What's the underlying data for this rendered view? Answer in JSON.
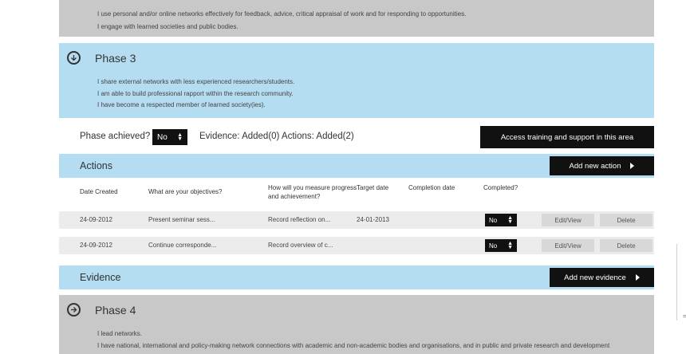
{
  "previous_phase": {
    "lines": [
      "I use personal and/or online networks effectively for feedback, advice, critical appraisal of work and for responding to opportunities.",
      "I engage with learned societies and public bodies."
    ]
  },
  "phase3": {
    "title": "Phase 3",
    "lines": [
      "I share external networks with less experienced researchers/students.",
      "I am able to build professional rapport within the research community.",
      "I have become a respected member of learned society(ies)."
    ]
  },
  "status": {
    "phase_achieved_label": "Phase achieved?",
    "phase_achieved_value": "No",
    "summary": "Evidence: Added(0) Actions: Added(2)",
    "access_button": "Access training and support in this area"
  },
  "actions": {
    "title": "Actions",
    "add_button": "Add new action",
    "headers": [
      "Date Created",
      "What are your objectives?",
      "How will you measure progress and achievement?",
      "Target date",
      "Completion date",
      "Completed?"
    ],
    "rows": [
      {
        "date_created": "24-09-2012",
        "objective": "Present seminar sess...",
        "measure": "Record reflection on...",
        "target_date": "24-01-2013",
        "completion_date": "",
        "completed": "No",
        "edit": "Edit/View",
        "delete": "Delete"
      },
      {
        "date_created": "24-09-2012",
        "objective": "Continue corresponde...",
        "measure": "Record overview of c...",
        "target_date": "",
        "completion_date": "",
        "completed": "No",
        "edit": "Edit/View",
        "delete": "Delete"
      }
    ]
  },
  "evidence": {
    "title": "Evidence",
    "add_button": "Add new evidence"
  },
  "phase4": {
    "title": "Phase 4",
    "lines": [
      "I lead networks.",
      "I have national, international and policy-making network connections with academic and non-academic bodies and organisations, and in public and private research and development"
    ]
  },
  "scroll_tick": "="
}
